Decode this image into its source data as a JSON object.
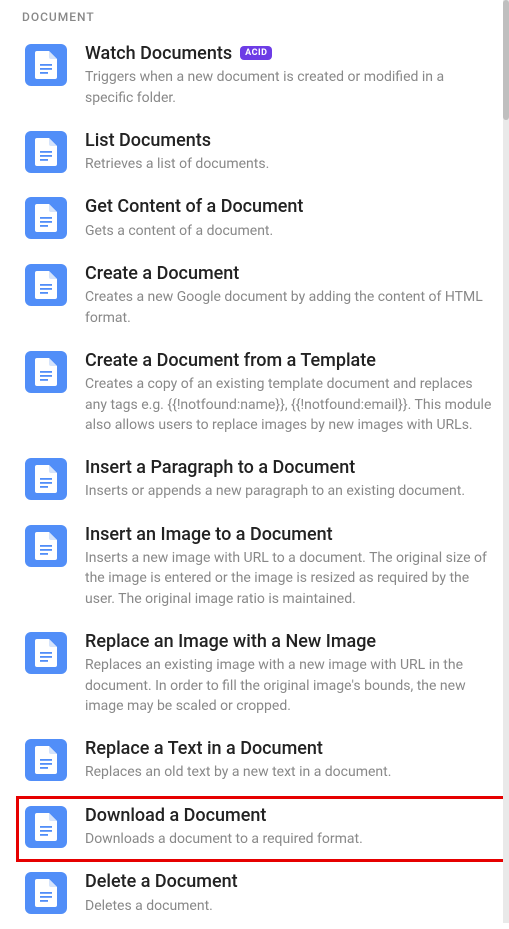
{
  "section_header": "DOCUMENT",
  "items": [
    {
      "title": "Watch Documents",
      "badge": "ACID",
      "desc": "Triggers when a new document is created or modified in a specific folder."
    },
    {
      "title": "List Documents",
      "desc": "Retrieves a list of documents."
    },
    {
      "title": "Get Content of a Document",
      "desc": "Gets a content of a document."
    },
    {
      "title": "Create a Document",
      "desc": "Creates a new Google document by adding the content of HTML format."
    },
    {
      "title": "Create a Document from a Template",
      "desc": "Creates a copy of an existing template document and replaces any tags e.g. {{!notfound:name}}, {{!notfound:email}}. This module also allows users to replace images by new images with URLs."
    },
    {
      "title": "Insert a Paragraph to a Document",
      "desc": "Inserts or appends a new paragraph to an existing document."
    },
    {
      "title": "Insert an Image to a Document",
      "desc": "Inserts a new image with URL to a document. The original size of the image is entered or the image is resized as required by the user. The original image ratio is maintained."
    },
    {
      "title": "Replace an Image with a New Image",
      "desc": "Replaces an existing image with a new image with URL in the document. In order to fill the original image's bounds, the new image may be scaled or cropped."
    },
    {
      "title": "Replace a Text in a Document",
      "desc": "Replaces an old text by a new text in a document."
    },
    {
      "title": "Download a Document",
      "desc": "Downloads a document to a required format.",
      "highlighted": true
    },
    {
      "title": "Delete a Document",
      "desc": "Deletes a document."
    }
  ]
}
